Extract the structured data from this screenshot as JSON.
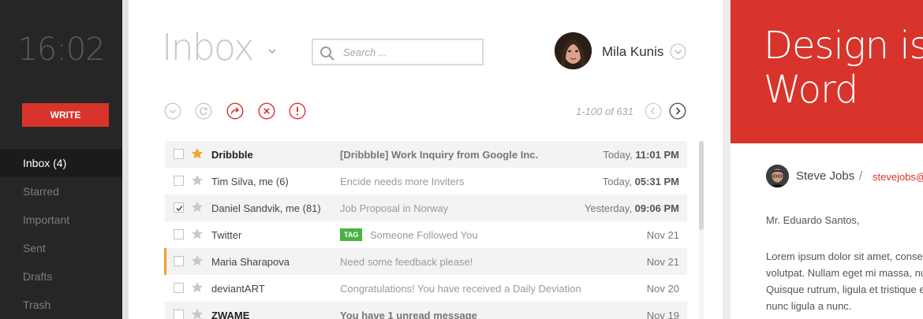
{
  "sidebar": {
    "clock": "16:02",
    "write_label": "WRITE",
    "items": [
      {
        "label": "Inbox (4)",
        "active": true
      },
      {
        "label": "Starred"
      },
      {
        "label": "Important"
      },
      {
        "label": "Sent"
      },
      {
        "label": "Drafts"
      },
      {
        "label": "Trash"
      }
    ]
  },
  "header": {
    "title": "Inbox",
    "search_placeholder": "Search ...",
    "user_name": "Mila Kunis"
  },
  "toolbar": {
    "icons": [
      "select-dropdown-icon",
      "refresh-icon",
      "forward-icon",
      "delete-icon",
      "report-spam-icon"
    ],
    "pager_text": "1-100 of 631"
  },
  "emails": [
    {
      "from": "Dribbble",
      "subject": "[Dribbble] Work Inquiry from Google Inc.",
      "date_prefix": "Today, ",
      "date_time": "11:01 PM",
      "starred": true,
      "checked": false,
      "unread": true
    },
    {
      "from": "Tim Silva, me (6)",
      "subject": "Encide needs more Inviters",
      "date_prefix": "Today, ",
      "date_time": "05:31 PM",
      "starred": false,
      "checked": false,
      "unread": false
    },
    {
      "from": "Daniel Sandvik, me (81)",
      "subject": "Job Proposal in Norway",
      "date_prefix": "Yesterday, ",
      "date_time": "09:06 PM",
      "starred": false,
      "checked": true,
      "unread": false
    },
    {
      "from": "Twitter",
      "tag": "TAG",
      "subject": "Someone Followed You",
      "date_prefix": "Nov 21",
      "date_time": "",
      "starred": false,
      "checked": false,
      "unread": false
    },
    {
      "from": "Maria Sharapova",
      "subject": "Need some feedback please!",
      "date_prefix": "Nov 21",
      "date_time": "",
      "starred": false,
      "checked": false,
      "unread": false,
      "flagged": true
    },
    {
      "from": "deviantART",
      "subject": "Congratulations! You have received a Daily Deviation",
      "date_prefix": "Nov 20",
      "date_time": "",
      "starred": false,
      "checked": false,
      "unread": false
    },
    {
      "from": "ZWAME",
      "subject": "You have 1 unread message",
      "date_prefix": "Nov 19",
      "date_time": "",
      "starred": false,
      "checked": false,
      "unread": true
    }
  ],
  "detail": {
    "title": "Design is\nWord",
    "sender_name": "Steve Jobs",
    "separator": "/",
    "sender_email": "stevejobs@",
    "greeting": "Mr. Eduardo Santos,",
    "body": "Lorem ipsum dolor sit amet, consec\nvolutpat. Nullam eget mi massa, nu\nQuisque rutrum, ligula et tristique e\nnunc ligula a nunc."
  },
  "colors": {
    "accent": "#d8342b",
    "sidebar_bg": "#262626",
    "star": "#f2a325",
    "tag": "#4ab244"
  }
}
